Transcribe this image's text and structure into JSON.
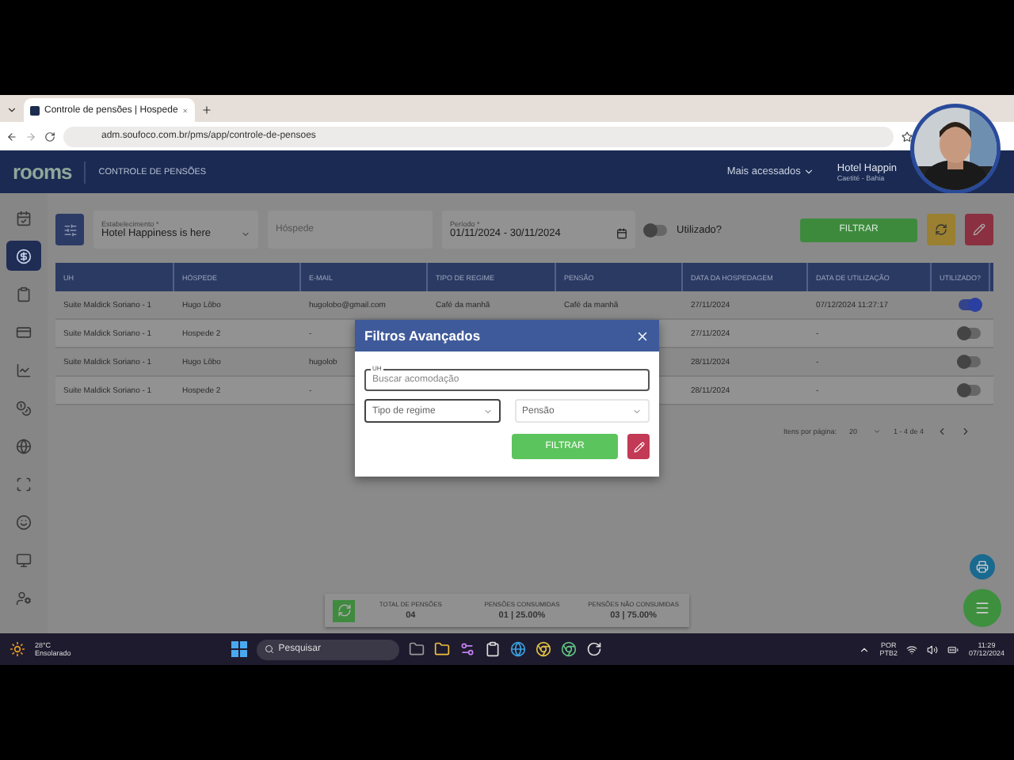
{
  "browser": {
    "tab_title": "Controle de pensões | Hospede",
    "url": "adm.soufoco.com.br/pms/app/controle-de-pensoes"
  },
  "app_header": {
    "logo": "rooms",
    "section": "CONTROLE DE PENSÕES",
    "menu": "Mais acessados",
    "hotel_name": "Hotel Happin",
    "hotel_location": "Caetité - Bahia"
  },
  "sidebar": {
    "items": [
      {
        "kind": "calendar",
        "selected": false
      },
      {
        "kind": "coin",
        "selected": true
      },
      {
        "kind": "clipboard",
        "selected": false
      },
      {
        "kind": "card",
        "selected": false
      },
      {
        "kind": "chart",
        "selected": false
      },
      {
        "kind": "coins",
        "selected": false
      },
      {
        "kind": "globe",
        "selected": false
      },
      {
        "kind": "scan",
        "selected": false
      },
      {
        "kind": "smile",
        "selected": false
      },
      {
        "kind": "monitor",
        "selected": false
      },
      {
        "kind": "usercog",
        "selected": false
      }
    ]
  },
  "filters": {
    "establishment_label": "Estabelecimento *",
    "establishment": "Hotel Happiness is here",
    "guest_placeholder": "Hóspede",
    "period_label": "Período *",
    "period": "01/11/2024 - 30/11/2024",
    "used_label": "Utilizado?",
    "used_on": false,
    "button": "FILTRAR"
  },
  "table": {
    "columns": [
      "UH",
      "HÓSPEDE",
      "E-MAIL",
      "TIPO DE REGIME",
      "PENSÃO",
      "DATA DA HOSPEDAGEM",
      "DATA DE UTILIZAÇÃO",
      "UTILIZADO?"
    ],
    "rows": [
      {
        "uh": "Suite Maldick Soriano - 1",
        "guest": "Hugo Lôbo",
        "email": "hugolobo@gmail.com",
        "regime": "Café da manhã",
        "pension": "Café da manhã",
        "stay_date": "27/11/2024",
        "use_date": "07/12/2024 11:27:17",
        "used": true
      },
      {
        "uh": "Suite Maldick Soriano - 1",
        "guest": "Hospede 2",
        "email": "-",
        "stay_date": "27/11/2024",
        "use_date": "-",
        "used": false
      },
      {
        "uh": "Suite Maldick Soriano - 1",
        "guest": "Hugo Lôbo",
        "email": "hugolob",
        "stay_date": "28/11/2024",
        "use_date": "-",
        "used": false
      },
      {
        "uh": "Suite Maldick Soriano - 1",
        "guest": "Hospede 2",
        "email": "-",
        "stay_date": "28/11/2024",
        "use_date": "-",
        "used": false
      }
    ]
  },
  "pagination": {
    "label": "Itens por página:",
    "per_page": "20",
    "range": "1 - 4 de 4"
  },
  "summary": [
    {
      "label": "TOTAL DE PENSÕES",
      "value": "04"
    },
    {
      "label": "PENSÕES CONSUMIDAS",
      "value": "01 | 25.00%"
    },
    {
      "label": "PENSÕES NÃO CONSUMIDAS",
      "value": "03 | 75.00%"
    }
  ],
  "modal": {
    "title": "Filtros Avançados",
    "uh_label": "UH",
    "uh_placeholder": "Buscar acomodação",
    "regime_placeholder": "Tipo de regime",
    "pension_placeholder": "Pensão",
    "button": "FILTRAR"
  },
  "taskbar": {
    "temperature": "28°C",
    "weather": "Ensolarado",
    "search": "Pesquisar",
    "language": "POR",
    "layout": "PTB2",
    "time": "11:29",
    "date": "07/12/2024"
  }
}
